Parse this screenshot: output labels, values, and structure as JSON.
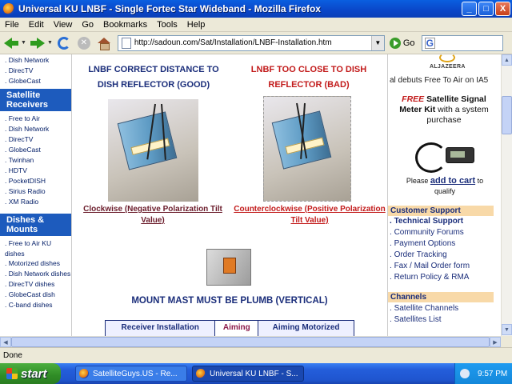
{
  "window": {
    "title": "Universal KU LNBF - Single Fortec Star Wideband - Mozilla Firefox",
    "buttons": {
      "minimize": "_",
      "maximize": "□",
      "close": "X"
    }
  },
  "menu": [
    "File",
    "Edit",
    "View",
    "Go",
    "Bookmarks",
    "Tools",
    "Help"
  ],
  "toolbar": {
    "url": "http://sadoun.com/Sat/Installation/LNBF-Installation.htm",
    "go_label": "Go",
    "search_value": ""
  },
  "left_sidebar": {
    "top_links": [
      "Dish Network",
      "DirecTV",
      "GlobeCast"
    ],
    "satellite_receivers": {
      "heading": "Satellite Receivers",
      "links": [
        "Free to Air",
        "Dish Network",
        "DirecTV",
        "GlobeCast",
        "Twinhan",
        "HDTV",
        "PocketDISH",
        "Sirius Radio",
        "XM Radio"
      ]
    },
    "dishes_mounts": {
      "heading": "Dishes & Mounts",
      "links": [
        "Free to Air KU dishes",
        "Motorized dishes",
        "Dish Network dishes",
        "DirecTV dishes",
        "GlobeCast dish",
        "C-band dishes"
      ]
    }
  },
  "main": {
    "good_heading": "LNBF CORRECT DISTANCE TO DISH REFLECTOR (GOOD)",
    "bad_heading": "LNBF TOO CLOSE TO DISH REFLECTOR (BAD)",
    "good_caption": "Clockwise (Negative Polarization Tilt Value)",
    "bad_caption": "Counterclockwise (Positive Polarization Tilt Value)",
    "plumb_heading": "MOUNT MAST MUST BE PLUMB (VERTICAL)",
    "nav_table": [
      "Receiver Installation",
      "Aiming",
      "Aiming Motorized"
    ]
  },
  "right_sidebar": {
    "logo_text": "ALJAZEERA",
    "debut_text": "al debuts Free To Air on IA5",
    "promo": {
      "free_word": "FREE",
      "kit_text": "Satellite Signal Meter Kit",
      "rest_text": "with a system purchase"
    },
    "cart_prefix": "Please",
    "cart_link": "add to cart",
    "cart_suffix": "to",
    "qualify": "qualify",
    "customer_support": {
      "heading": "Customer Support",
      "links": [
        "Technical Support",
        "Community Forums",
        "Payment Options",
        "Order Tracking",
        "Fax / Mail Order form",
        "Return Policy & RMA"
      ]
    },
    "channels": {
      "heading": "Channels",
      "links": [
        "Satellite Channels",
        "Satellites List"
      ]
    }
  },
  "status": "Done",
  "taskbar": {
    "start": "start",
    "tasks": [
      "SatelliteGuys.US - Re...",
      "Universal KU LNBF - S..."
    ],
    "clock": "9:57 PM"
  }
}
